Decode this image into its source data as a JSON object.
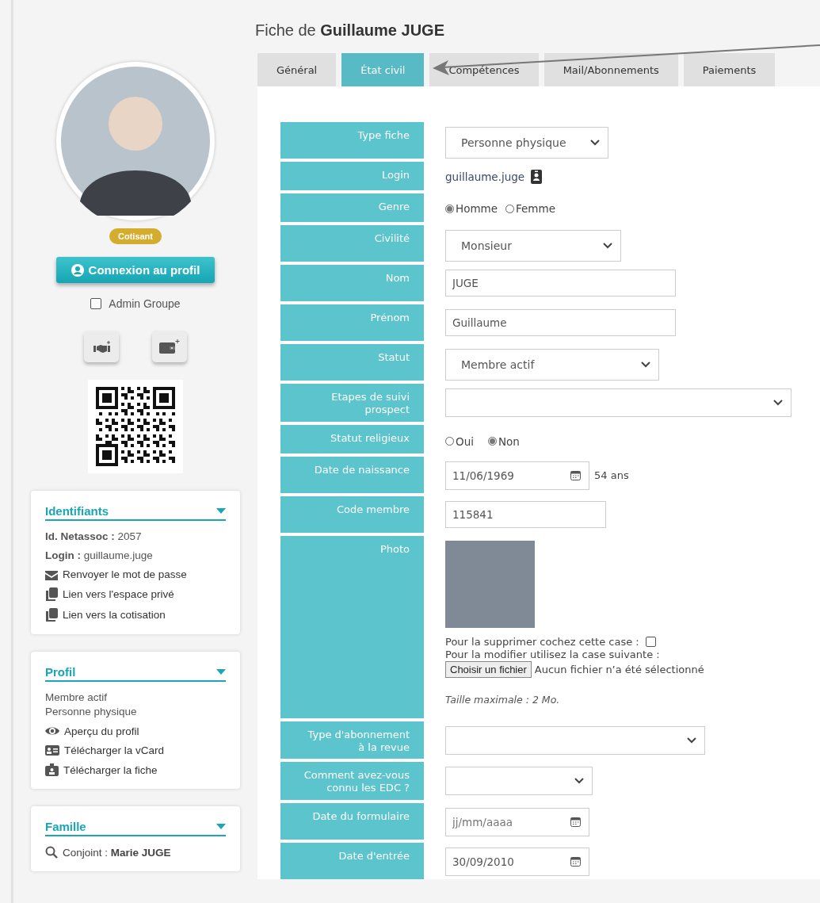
{
  "page_title": "Fiche de **Guillaume JUGE**",
  "tabs": [
    {
      "label": "Général",
      "selected": false
    },
    {
      "label": "État civil",
      "selected": true
    },
    {
      "label": "Compétences",
      "selected": false
    },
    {
      "label": "Mail/Abonnements",
      "selected": false
    },
    {
      "label": "Paiements",
      "selected": false
    }
  ],
  "sidebar": {
    "badge": "Cotisant",
    "profile_button": "Connexion au profil",
    "admin_checkbox": {
      "label": "Admin Groupe",
      "checked": false
    },
    "cards": [
      {
        "title": "Identifiants",
        "items": [
          {
            "kind": "field",
            "text": "**Id. Netassoc :** 2057"
          },
          {
            "kind": "field",
            "text": "**Login :** guillaume.juge"
          },
          {
            "kind": "mail",
            "text": "Renvoyer le mot de passe"
          },
          {
            "kind": "copy",
            "text": "Lien vers l'espace privé"
          },
          {
            "kind": "copy",
            "text": "Lien vers la cotisation"
          }
        ]
      },
      {
        "title": "Profil",
        "items": [
          {
            "kind": "plain",
            "text": "Membre actif"
          },
          {
            "kind": "plain",
            "text": "Personne physique"
          },
          {
            "kind": "eye",
            "text": "Aperçu du profil"
          },
          {
            "kind": "vcard",
            "text": "Télécharger la vCard"
          },
          {
            "kind": "badge",
            "text": "Télécharger la fiche"
          }
        ]
      },
      {
        "title": "Famille",
        "items": [
          {
            "kind": "search",
            "text": "Conjoint : **Marie JUGE**"
          }
        ]
      }
    ]
  },
  "form": {
    "rows": [
      {
        "label": "Type fiche",
        "kind": "select",
        "value": "Personne physique"
      },
      {
        "label": "Login",
        "kind": "login",
        "value": "guillaume.juge"
      },
      {
        "label": "Genre",
        "kind": "radio",
        "options": [
          {
            "label": "Homme",
            "selected": true
          },
          {
            "label": "Femme",
            "selected": false
          }
        ]
      },
      {
        "label": "Civilité",
        "kind": "select",
        "value": "Monsieur"
      },
      {
        "label": "Nom",
        "kind": "text",
        "value": "JUGE"
      },
      {
        "label": "Prénom",
        "kind": "text",
        "value": "Guillaume"
      },
      {
        "label": "Statut",
        "kind": "select",
        "value": "Membre actif"
      },
      {
        "label": "Etapes de suivi prospect",
        "kind": "select"
      },
      {
        "label": "Statut religieux",
        "kind": "radio",
        "options": [
          {
            "label": "Oui",
            "selected": false
          },
          {
            "label": "Non",
            "selected": true
          }
        ]
      },
      {
        "label": "Date de naissance",
        "kind": "date",
        "value": "11/06/1969",
        "note": "54 ans"
      },
      {
        "label": "Code membre",
        "kind": "text",
        "value": "115841"
      },
      {
        "label": "Photo",
        "kind": "photo",
        "delete_label": "Pour la supprimer cochez cette case :",
        "delete_checked": false,
        "modify_label": "Pour la modifier utilisez la case suivante :",
        "file_button": "Choisir un fichier",
        "file_status": "Aucun fichier n’a été sélectionné",
        "max_size": "Taille maximale : 2 Mo."
      },
      {
        "label": "Type d'abonnement à la revue",
        "kind": "select"
      },
      {
        "label": "Comment avez-vous connu les EDC ?",
        "kind": "select"
      },
      {
        "label": "Date du formulaire",
        "kind": "date",
        "placeholder": "jj/mm/aaaa"
      },
      {
        "label": "Date d'entrée",
        "kind": "date",
        "value": "30/09/2010"
      }
    ]
  }
}
